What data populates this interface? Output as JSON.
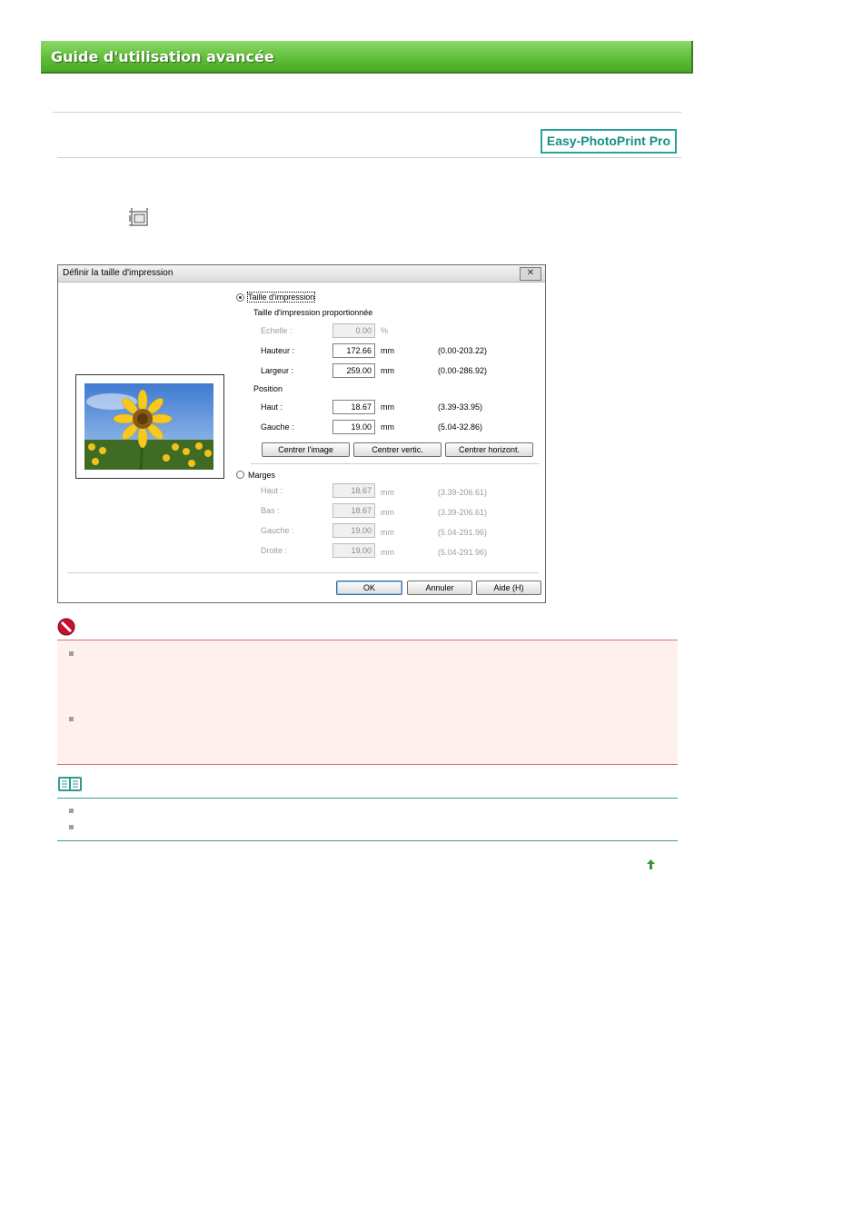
{
  "header": {
    "title": "Guide d'utilisation avancée"
  },
  "product_badge": "Easy-PhotoPrint Pro",
  "icons": {
    "toolbar": "print-size-icon",
    "important": "stop-icon",
    "note": "book-icon",
    "top": "back-to-top-icon"
  },
  "dialog": {
    "title": "Définir la taille d'impression",
    "close": "✕",
    "print_size_radio": "Taille d'impression",
    "proportional_label": "Taille d'impression proportionnée",
    "scale": {
      "label": "Echelle :",
      "value": "0.00",
      "unit": "%"
    },
    "height": {
      "label": "Hauteur :",
      "value": "172.66",
      "unit": "mm",
      "range": "(0.00-203.22)"
    },
    "width": {
      "label": "Largeur :",
      "value": "259.00",
      "unit": "mm",
      "range": "(0.00-286.92)"
    },
    "position_label": "Position",
    "top": {
      "label": "Haut :",
      "value": "18.67",
      "unit": "mm",
      "range": "(3.39-33.95)"
    },
    "left": {
      "label": "Gauche :",
      "value": "19.00",
      "unit": "mm",
      "range": "(5.04-32.86)"
    },
    "buttons": {
      "center_image": "Centrer l'image",
      "center_vertical": "Centrer vertic.",
      "center_horizontal": "Centrer horizont."
    },
    "margins_radio": "Marges",
    "margins": [
      {
        "label": "Haut :",
        "value": "18.67",
        "unit": "mm",
        "range": "(3.39-206.61)"
      },
      {
        "label": "Bas :",
        "value": "18.67",
        "unit": "mm",
        "range": "(3.39-206.61)"
      },
      {
        "label": "Gauche :",
        "value": "19.00",
        "unit": "mm",
        "range": "(5.04-291.96)"
      },
      {
        "label": "Droite :",
        "value": "19.00",
        "unit": "mm",
        "range": "(5.04-291.96)"
      }
    ],
    "ok": "OK",
    "cancel": "Annuler",
    "help": "Aide (H)"
  },
  "colors": {
    "banner": "#5fbf38",
    "badge": "#2aa39a",
    "important_bg": "#fff0f0",
    "important_border": "#e07070",
    "note_border": "#3a9a92"
  }
}
